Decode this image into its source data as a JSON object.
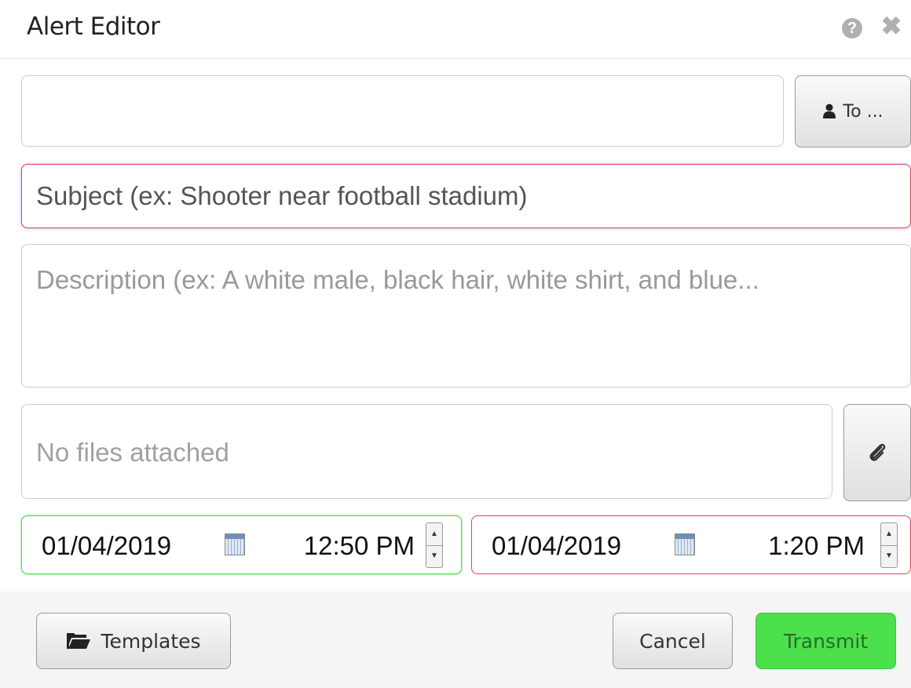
{
  "header": {
    "title": "Alert Editor",
    "help_icon": "?",
    "close_icon": "✖"
  },
  "form": {
    "recipients_value": "",
    "to_button_label": "To ...",
    "subject_placeholder": "Subject (ex: Shooter near football stadium)",
    "subject_value": "",
    "description_placeholder": "Description (ex: A white male, black hair, white shirt, and blue...",
    "description_value": "",
    "attachments_text": "No files attached"
  },
  "schedule": {
    "start": {
      "date": "01/04/2019",
      "time": "12:50 PM"
    },
    "end": {
      "date": "01/04/2019",
      "time": "1:20 PM"
    }
  },
  "footer": {
    "templates_label": "Templates",
    "cancel_label": "Cancel",
    "transmit_label": "Transmit"
  },
  "colors": {
    "start_border": "#4cdc4c",
    "end_border": "#e0405a",
    "subject_border": "#e0405a",
    "transmit_bg": "#4ce04c"
  },
  "icons": {
    "to_button": "person-icon",
    "attach_button": "paperclip-icon",
    "templates_button": "folder-open-icon",
    "date_picker": "calendar-icon"
  }
}
